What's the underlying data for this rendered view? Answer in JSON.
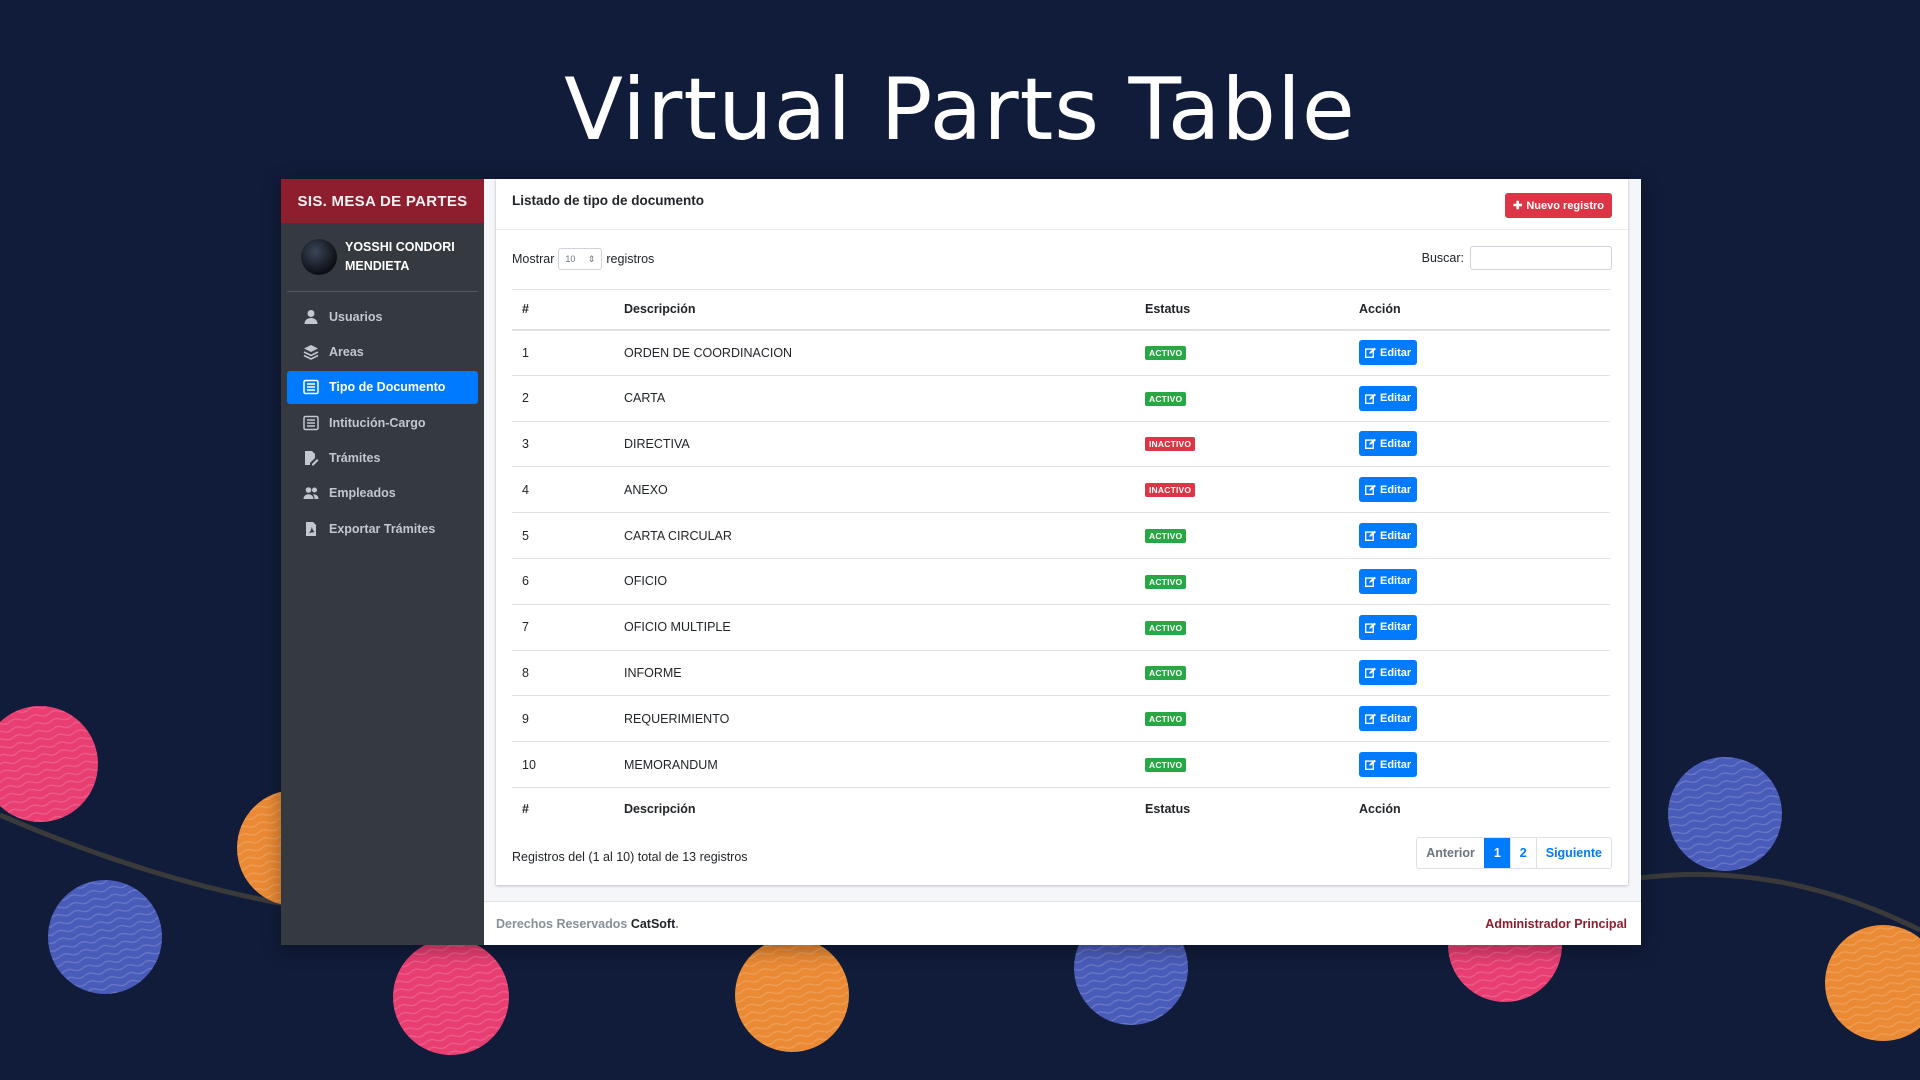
{
  "slide": {
    "title": "Virtual Parts Table"
  },
  "colors": {
    "background": "#111c3a",
    "brand": "#8e1d2e",
    "primary": "#007bff",
    "danger": "#dc3545",
    "success": "#28a745",
    "sidebar": "#343a40"
  },
  "sidebar": {
    "brand": "SIS. MESA DE PARTES",
    "user": {
      "name_line1": "YOSSHI CONDORI",
      "name_line2": "MENDIETA"
    },
    "items": [
      {
        "label": "Usuarios",
        "icon": "user-icon"
      },
      {
        "label": "Areas",
        "icon": "layers-icon"
      },
      {
        "label": "Tipo de Documento",
        "icon": "list-icon",
        "active": true
      },
      {
        "label": "Intitución-Cargo",
        "icon": "list-icon"
      },
      {
        "label": "Trámites",
        "icon": "edit-file-icon"
      },
      {
        "label": "Empleados",
        "icon": "users-icon"
      },
      {
        "label": "Exportar Trámites",
        "icon": "pdf-file-icon"
      }
    ]
  },
  "card": {
    "title": "Listado de tipo de documento",
    "new_button": "Nuevo registro",
    "show_label": "Mostrar",
    "show_value": "10",
    "records_label": "registros",
    "search_label": "Buscar:",
    "search_value": ""
  },
  "table": {
    "columns": [
      "#",
      "Descripción",
      "Estatus",
      "Acción"
    ],
    "rows": [
      {
        "num": "1",
        "desc": "ORDEN DE COORDINACION",
        "status": "ACTIVO",
        "action": "Editar"
      },
      {
        "num": "2",
        "desc": "CARTA",
        "status": "ACTIVO",
        "action": "Editar"
      },
      {
        "num": "3",
        "desc": "DIRECTIVA",
        "status": "INACTIVO",
        "action": "Editar"
      },
      {
        "num": "4",
        "desc": "ANEXO",
        "status": "INACTIVO",
        "action": "Editar"
      },
      {
        "num": "5",
        "desc": "CARTA CIRCULAR",
        "status": "ACTIVO",
        "action": "Editar"
      },
      {
        "num": "6",
        "desc": "OFICIO",
        "status": "ACTIVO",
        "action": "Editar"
      },
      {
        "num": "7",
        "desc": "OFICIO MULTIPLE",
        "status": "ACTIVO",
        "action": "Editar"
      },
      {
        "num": "8",
        "desc": "INFORME",
        "status": "ACTIVO",
        "action": "Editar"
      },
      {
        "num": "9",
        "desc": "REQUERIMIENTO",
        "status": "ACTIVO",
        "action": "Editar"
      },
      {
        "num": "10",
        "desc": "MEMORANDUM",
        "status": "ACTIVO",
        "action": "Editar"
      }
    ],
    "info": "Registros del (1 al 10) total de 13 registros"
  },
  "pagination": {
    "prev": "Anterior",
    "pages": [
      "1",
      "2"
    ],
    "current": "1",
    "next": "Siguiente"
  },
  "footer": {
    "rights": "Derechos Reservados",
    "company": "CatSoft",
    "period": ".",
    "role": "Administrador Principal"
  }
}
